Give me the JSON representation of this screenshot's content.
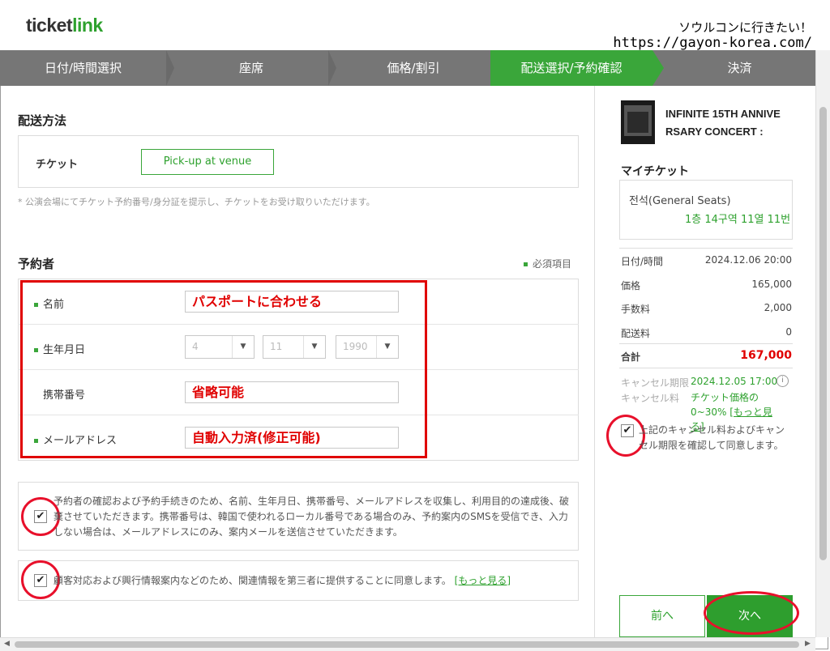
{
  "header": {
    "logo_part1": "ticket",
    "logo_part2": "link",
    "watermark_line1": "ソウルコンに行きたい！",
    "watermark_line2": "https://gayon-korea.com/"
  },
  "steps": [
    {
      "label": "日付/時間選択",
      "active": false
    },
    {
      "label": "座席",
      "active": false
    },
    {
      "label": "価格/割引",
      "active": false
    },
    {
      "label": "配送選択/予約確認",
      "active": true
    },
    {
      "label": "決済",
      "active": false
    }
  ],
  "delivery": {
    "title": "配送方法",
    "ticket_label": "チケット",
    "option_button": "Pick-up at venue",
    "note": "* 公演会場にてチケット予約番号/身分証を提示し、チケットをお受け取りいただけます。"
  },
  "booker": {
    "title": "予約者",
    "required_label": "必須項目",
    "name_label": "名前",
    "name_value": "パスポートに合わせる",
    "birth_label": "生年月日",
    "birth_selects": [
      "4",
      "11",
      "1990"
    ],
    "phone_label": "携帯番号",
    "phone_value": "省略可能",
    "email_label": "メールアドレス",
    "email_value": "自動入力済(修正可能)"
  },
  "agreements": {
    "agree1_text": "予約者の確認および予約手続きのため、名前、生年月日、携帯番号、メールアドレスを収集し、利用目的の達成後、破棄させていただきます。携帯番号は、韓国で使われるローカル番号である場合のみ、予約案内のSMSを受信でき、入力しない場合は、メールアドレスにのみ、案内メールを送信させていただきます。",
    "agree2_text": "顧客対応および興行情報案内などのため、関連情報を第三者に提供することに同意します。",
    "agree2_link": "[もっと見る]"
  },
  "summary": {
    "event_title": "INFINITE 15TH ANNIVERSARY CONCERT :",
    "my_ticket_title": "マイチケット",
    "seat_type": "전석(General Seats)",
    "seat_detail": "1층 14구역 11열 11번",
    "rows": [
      {
        "label": "日付/時間",
        "value": "2024.12.06 20:00"
      },
      {
        "label": "価格",
        "value": "165,000"
      },
      {
        "label": "手数料",
        "value": "2,000"
      },
      {
        "label": "配送料",
        "value": "0"
      }
    ],
    "total_label": "合計",
    "total_value": "167,000",
    "cancel_deadline_label": "キャンセル期限",
    "cancel_deadline_value": "2024.12.05 17:00",
    "cancel_fee_label": "キャンセル料",
    "cancel_fee_value": "チケット価格の0~30%",
    "cancel_fee_link": "[もっと見る]",
    "info_icon": "i",
    "confirm_text": "上記のキャンセル料およびキャンセル期限を確認して同意します。",
    "prev_button": "前へ",
    "next_button": "次へ"
  },
  "colors": {
    "accent": "#3aa63a",
    "step_bar": "#767676",
    "annotation_red": "#e00000"
  }
}
